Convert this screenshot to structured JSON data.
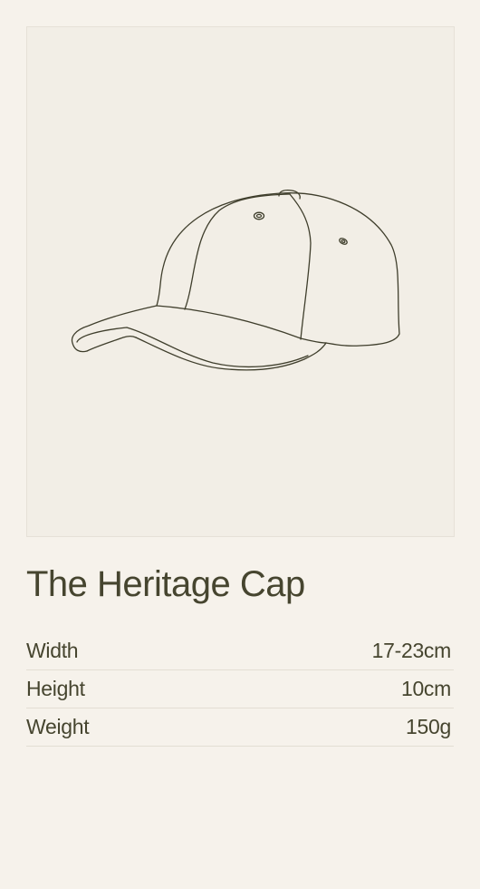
{
  "product": {
    "title": "The Heritage Cap",
    "image_icon": "cap-illustration",
    "specs": [
      {
        "label": "Width",
        "value": "17-23cm"
      },
      {
        "label": "Height",
        "value": "10cm"
      },
      {
        "label": "Weight",
        "value": "150g"
      }
    ]
  },
  "colors": {
    "page_background": "#f6f2eb",
    "image_background": "#f2eee6",
    "text": "#46452f",
    "divider": "#e3ded3"
  }
}
